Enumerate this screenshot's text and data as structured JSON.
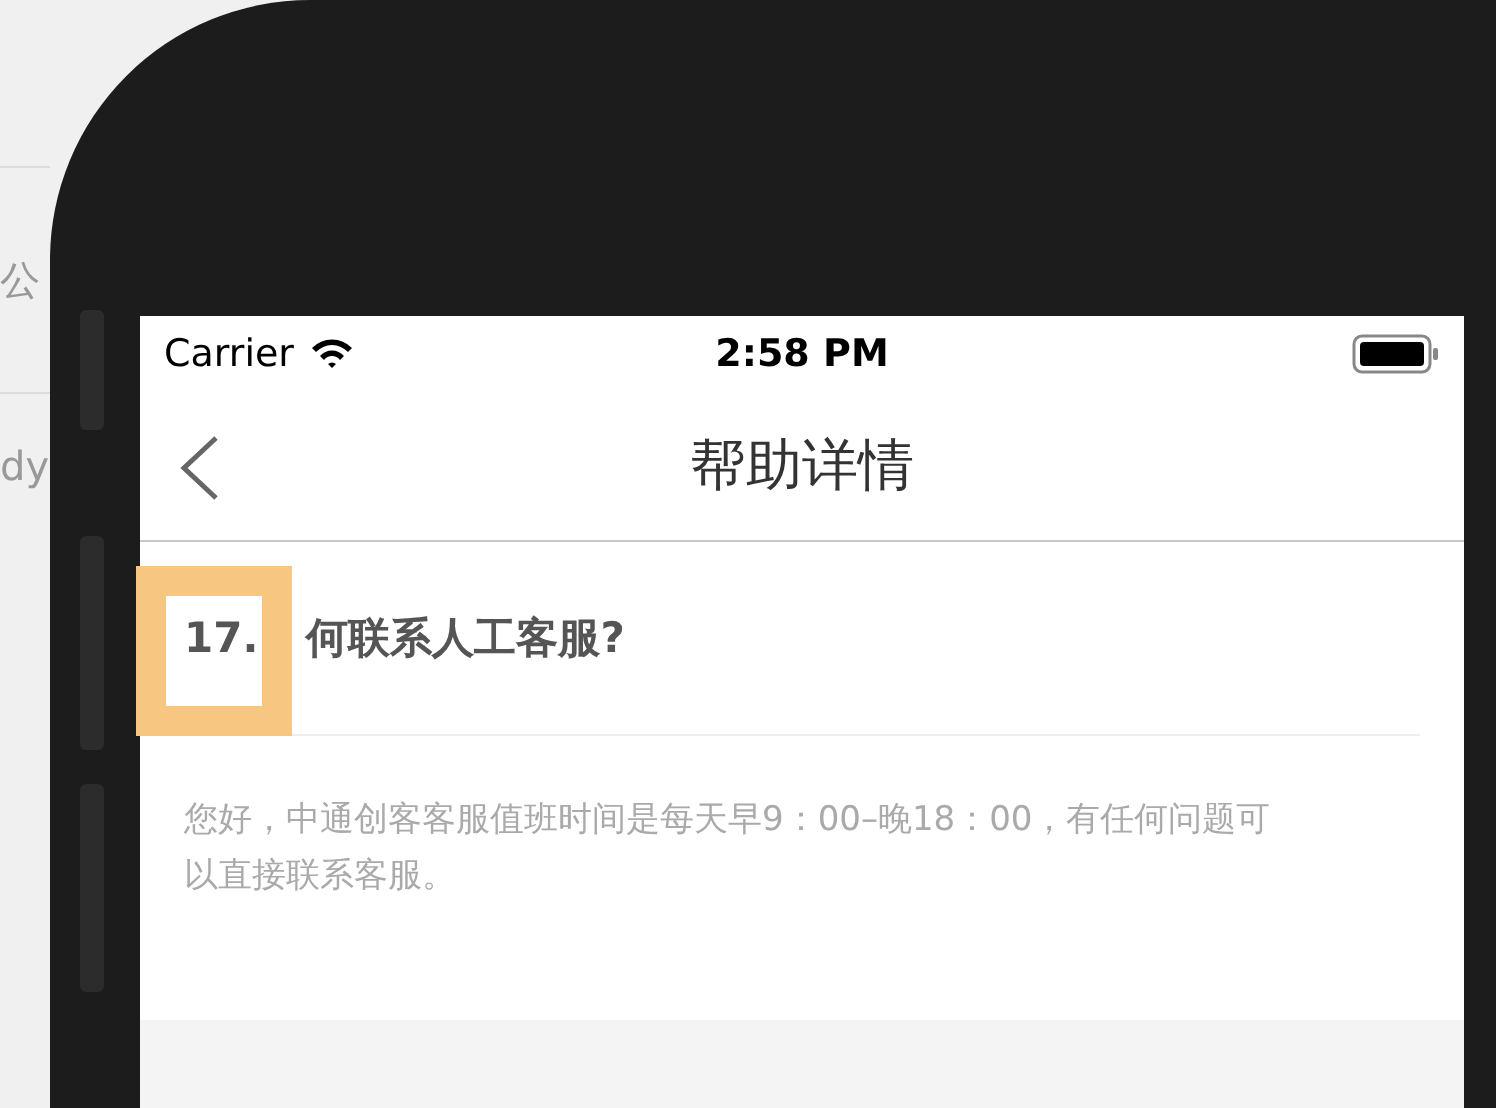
{
  "background_fragments": [
    "公",
    "dy"
  ],
  "status_bar": {
    "carrier": "Carrier",
    "time": "2:58 PM"
  },
  "nav_bar": {
    "title": "帮助详情"
  },
  "question": {
    "number": "17.",
    "title": "何联系人工客服?",
    "highlighted": true
  },
  "answer": {
    "text": "您好，中通创客客服值班时间是每天早9：00–晚18：00，有任何问题可以直接联系客服。"
  }
}
